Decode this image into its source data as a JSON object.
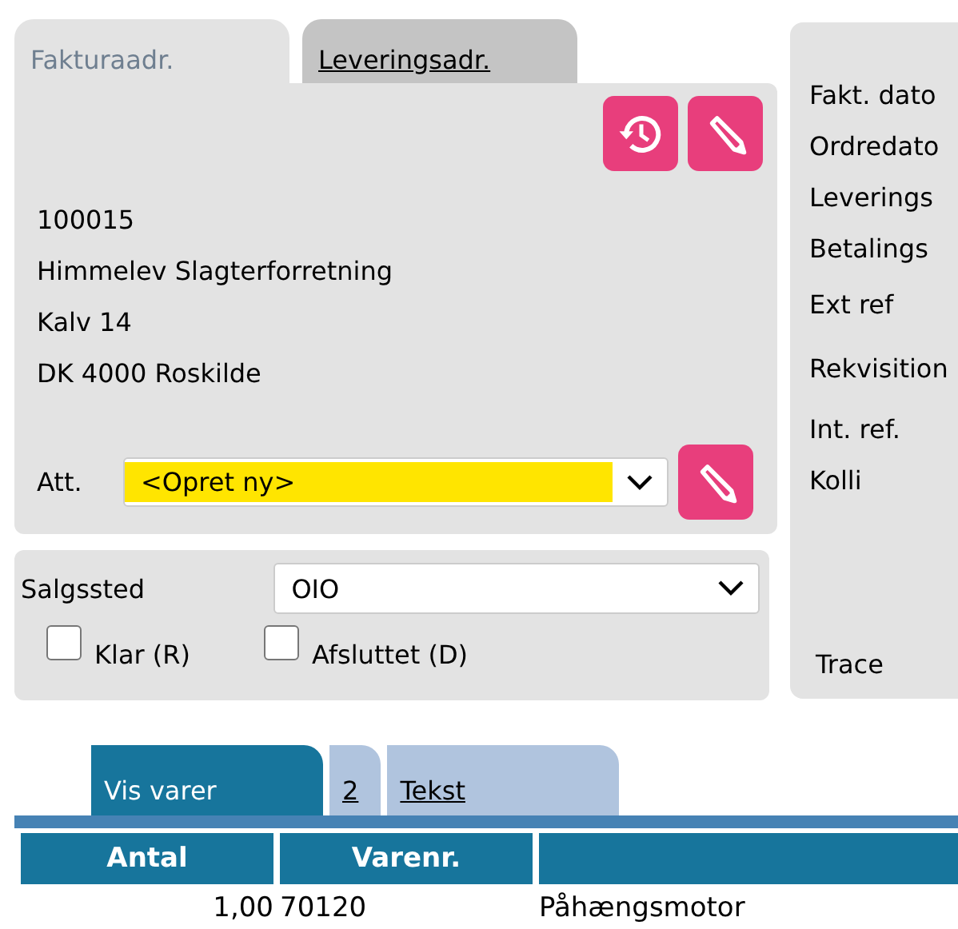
{
  "address_tabs": [
    {
      "label": "Fakturaadr.",
      "selected": true
    },
    {
      "label": "Leveringsadr.",
      "selected": false
    }
  ],
  "address_actions": [
    {
      "kind": "history"
    },
    {
      "kind": "edit"
    }
  ],
  "address_lines": [
    "100015",
    "Himmelev Slagterforretning",
    "Kalv 14",
    "DK 4000 Roskilde"
  ],
  "att": {
    "label": "Att.",
    "value": "<Opret ny>",
    "highlighted": true
  },
  "salgssted": {
    "label": "Salgssted",
    "value": "OIO"
  },
  "checkboxes": [
    {
      "label": "Klar (R)",
      "checked": false
    },
    {
      "label": "Afsluttet (D)",
      "checked": false
    }
  ],
  "info_labels": [
    "Fakt. dato",
    "Ordredato",
    "Leverings",
    "Betalings",
    "Ext ref",
    "Rekvisition",
    "Int. ref.",
    "Kolli"
  ],
  "trace": "Trace",
  "line_tabs": [
    {
      "label": "Vis varer",
      "selected": true
    },
    {
      "label": "2",
      "selected": false
    },
    {
      "label": "Tekst",
      "selected": false
    }
  ],
  "table": {
    "columns": [
      "Antal",
      "Varenr.",
      ""
    ],
    "rows": [
      [
        "1,00",
        "70120",
        "Påhængsmotor"
      ]
    ]
  }
}
